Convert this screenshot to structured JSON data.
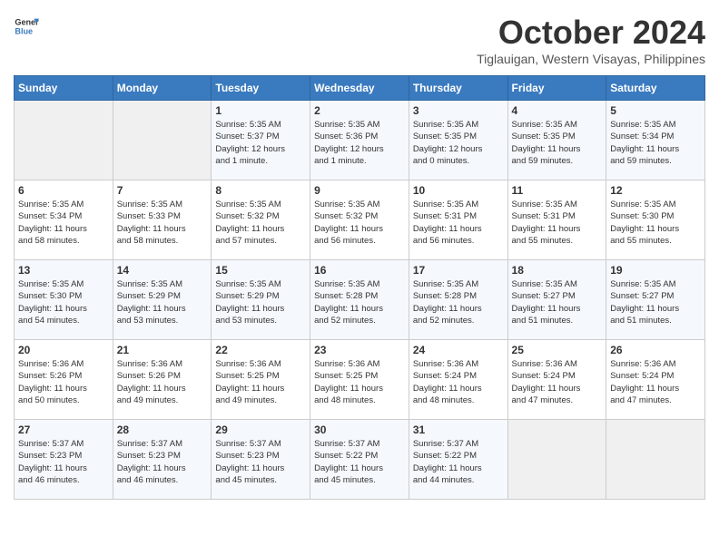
{
  "logo": {
    "line1": "General",
    "line2": "Blue"
  },
  "title": "October 2024",
  "subtitle": "Tiglauigan, Western Visayas, Philippines",
  "days_header": [
    "Sunday",
    "Monday",
    "Tuesday",
    "Wednesday",
    "Thursday",
    "Friday",
    "Saturday"
  ],
  "weeks": [
    [
      {
        "day": "",
        "info": ""
      },
      {
        "day": "",
        "info": ""
      },
      {
        "day": "1",
        "info": "Sunrise: 5:35 AM\nSunset: 5:37 PM\nDaylight: 12 hours\nand 1 minute."
      },
      {
        "day": "2",
        "info": "Sunrise: 5:35 AM\nSunset: 5:36 PM\nDaylight: 12 hours\nand 1 minute."
      },
      {
        "day": "3",
        "info": "Sunrise: 5:35 AM\nSunset: 5:35 PM\nDaylight: 12 hours\nand 0 minutes."
      },
      {
        "day": "4",
        "info": "Sunrise: 5:35 AM\nSunset: 5:35 PM\nDaylight: 11 hours\nand 59 minutes."
      },
      {
        "day": "5",
        "info": "Sunrise: 5:35 AM\nSunset: 5:34 PM\nDaylight: 11 hours\nand 59 minutes."
      }
    ],
    [
      {
        "day": "6",
        "info": "Sunrise: 5:35 AM\nSunset: 5:34 PM\nDaylight: 11 hours\nand 58 minutes."
      },
      {
        "day": "7",
        "info": "Sunrise: 5:35 AM\nSunset: 5:33 PM\nDaylight: 11 hours\nand 58 minutes."
      },
      {
        "day": "8",
        "info": "Sunrise: 5:35 AM\nSunset: 5:32 PM\nDaylight: 11 hours\nand 57 minutes."
      },
      {
        "day": "9",
        "info": "Sunrise: 5:35 AM\nSunset: 5:32 PM\nDaylight: 11 hours\nand 56 minutes."
      },
      {
        "day": "10",
        "info": "Sunrise: 5:35 AM\nSunset: 5:31 PM\nDaylight: 11 hours\nand 56 minutes."
      },
      {
        "day": "11",
        "info": "Sunrise: 5:35 AM\nSunset: 5:31 PM\nDaylight: 11 hours\nand 55 minutes."
      },
      {
        "day": "12",
        "info": "Sunrise: 5:35 AM\nSunset: 5:30 PM\nDaylight: 11 hours\nand 55 minutes."
      }
    ],
    [
      {
        "day": "13",
        "info": "Sunrise: 5:35 AM\nSunset: 5:30 PM\nDaylight: 11 hours\nand 54 minutes."
      },
      {
        "day": "14",
        "info": "Sunrise: 5:35 AM\nSunset: 5:29 PM\nDaylight: 11 hours\nand 53 minutes."
      },
      {
        "day": "15",
        "info": "Sunrise: 5:35 AM\nSunset: 5:29 PM\nDaylight: 11 hours\nand 53 minutes."
      },
      {
        "day": "16",
        "info": "Sunrise: 5:35 AM\nSunset: 5:28 PM\nDaylight: 11 hours\nand 52 minutes."
      },
      {
        "day": "17",
        "info": "Sunrise: 5:35 AM\nSunset: 5:28 PM\nDaylight: 11 hours\nand 52 minutes."
      },
      {
        "day": "18",
        "info": "Sunrise: 5:35 AM\nSunset: 5:27 PM\nDaylight: 11 hours\nand 51 minutes."
      },
      {
        "day": "19",
        "info": "Sunrise: 5:35 AM\nSunset: 5:27 PM\nDaylight: 11 hours\nand 51 minutes."
      }
    ],
    [
      {
        "day": "20",
        "info": "Sunrise: 5:36 AM\nSunset: 5:26 PM\nDaylight: 11 hours\nand 50 minutes."
      },
      {
        "day": "21",
        "info": "Sunrise: 5:36 AM\nSunset: 5:26 PM\nDaylight: 11 hours\nand 49 minutes."
      },
      {
        "day": "22",
        "info": "Sunrise: 5:36 AM\nSunset: 5:25 PM\nDaylight: 11 hours\nand 49 minutes."
      },
      {
        "day": "23",
        "info": "Sunrise: 5:36 AM\nSunset: 5:25 PM\nDaylight: 11 hours\nand 48 minutes."
      },
      {
        "day": "24",
        "info": "Sunrise: 5:36 AM\nSunset: 5:24 PM\nDaylight: 11 hours\nand 48 minutes."
      },
      {
        "day": "25",
        "info": "Sunrise: 5:36 AM\nSunset: 5:24 PM\nDaylight: 11 hours\nand 47 minutes."
      },
      {
        "day": "26",
        "info": "Sunrise: 5:36 AM\nSunset: 5:24 PM\nDaylight: 11 hours\nand 47 minutes."
      }
    ],
    [
      {
        "day": "27",
        "info": "Sunrise: 5:37 AM\nSunset: 5:23 PM\nDaylight: 11 hours\nand 46 minutes."
      },
      {
        "day": "28",
        "info": "Sunrise: 5:37 AM\nSunset: 5:23 PM\nDaylight: 11 hours\nand 46 minutes."
      },
      {
        "day": "29",
        "info": "Sunrise: 5:37 AM\nSunset: 5:23 PM\nDaylight: 11 hours\nand 45 minutes."
      },
      {
        "day": "30",
        "info": "Sunrise: 5:37 AM\nSunset: 5:22 PM\nDaylight: 11 hours\nand 45 minutes."
      },
      {
        "day": "31",
        "info": "Sunrise: 5:37 AM\nSunset: 5:22 PM\nDaylight: 11 hours\nand 44 minutes."
      },
      {
        "day": "",
        "info": ""
      },
      {
        "day": "",
        "info": ""
      }
    ]
  ]
}
